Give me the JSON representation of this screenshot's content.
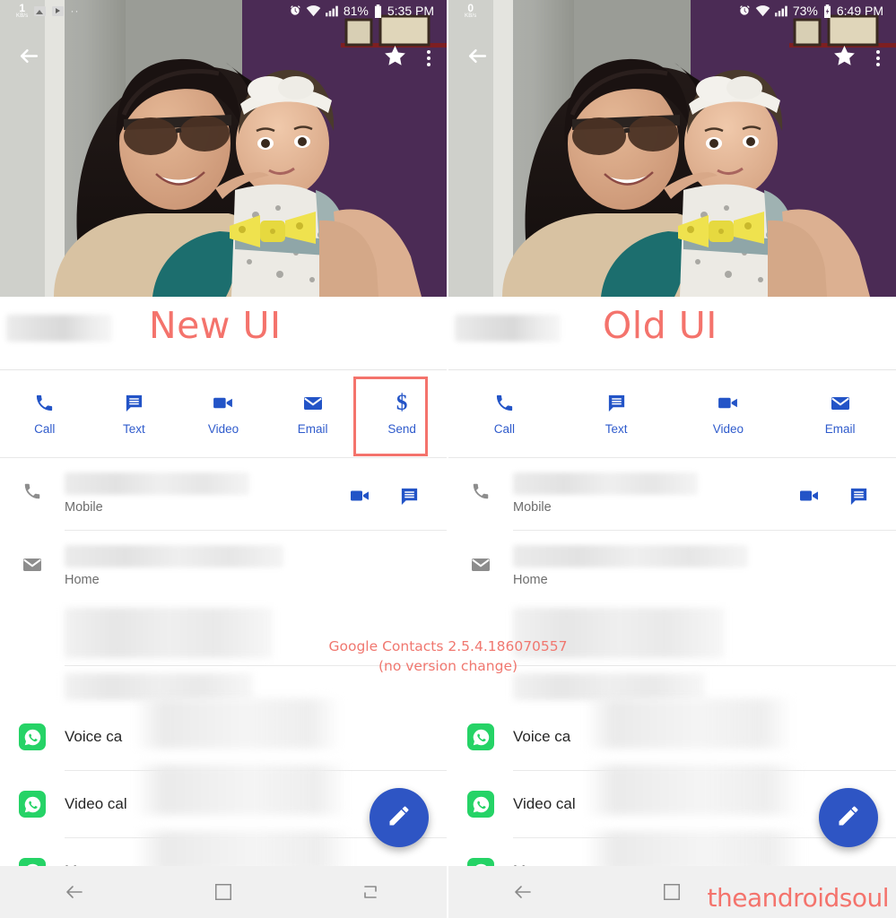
{
  "annotations": {
    "left_label": "New UI",
    "right_label": "Old UI",
    "center_note_line1": "Google Contacts 2.5.4.186070557",
    "center_note_line2": "(no version change)",
    "watermark": "theandroidsoul",
    "highlight_color": "#f4736c",
    "accent_blue": "#2354c7",
    "whatsapp_green": "#25D366",
    "fab_blue": "#2e55c4"
  },
  "left": {
    "statusbar": {
      "net_speed_value": "1",
      "net_speed_unit": "KB/s",
      "battery": "81%",
      "time": "5:35 PM",
      "icons": [
        "alarm-icon",
        "wifi-icon",
        "signal-icon",
        "battery-icon"
      ]
    },
    "appbar": {
      "back": "back-arrow-icon",
      "star": "star-icon",
      "overflow": "more-vert-icon"
    },
    "actions": [
      {
        "label": "Call",
        "icon": "phone-icon"
      },
      {
        "label": "Text",
        "icon": "message-icon"
      },
      {
        "label": "Video",
        "icon": "videocam-icon"
      },
      {
        "label": "Email",
        "icon": "email-icon"
      },
      {
        "label": "Send",
        "icon": "dollar-icon",
        "highlighted": true
      }
    ],
    "details": [
      {
        "icon": "phone-icon",
        "label": "Mobile",
        "trailing": [
          "videocam-icon",
          "message-icon"
        ]
      },
      {
        "icon": "email-icon",
        "label": "Home",
        "trailing": []
      }
    ],
    "whatsapp_rows": [
      {
        "label": "Voice ca",
        "icon": "whatsapp-icon"
      },
      {
        "label": "Video cal",
        "icon": "whatsapp-icon"
      },
      {
        "label": "Message",
        "icon": "whatsapp-icon"
      }
    ],
    "fab": {
      "icon": "pencil-icon"
    },
    "navbar": [
      {
        "icon": "nav-back-icon"
      },
      {
        "icon": "nav-home-icon"
      },
      {
        "icon": "nav-recents-icon"
      }
    ]
  },
  "right": {
    "statusbar": {
      "net_speed_value": "0",
      "net_speed_unit": "KB/s",
      "battery": "73%",
      "time": "6:49 PM",
      "icons": [
        "alarm-icon",
        "wifi-icon",
        "signal-icon",
        "battery-charging-icon"
      ]
    },
    "appbar": {
      "back": "back-arrow-icon",
      "star": "star-icon",
      "overflow": "more-vert-icon"
    },
    "actions": [
      {
        "label": "Call",
        "icon": "phone-icon"
      },
      {
        "label": "Text",
        "icon": "message-icon"
      },
      {
        "label": "Video",
        "icon": "videocam-icon"
      },
      {
        "label": "Email",
        "icon": "email-icon"
      }
    ],
    "details": [
      {
        "icon": "phone-icon",
        "label": "Mobile",
        "trailing": [
          "videocam-icon",
          "message-icon"
        ]
      },
      {
        "icon": "email-icon",
        "label": "Home",
        "trailing": []
      }
    ],
    "whatsapp_rows": [
      {
        "label": "Voice ca",
        "icon": "whatsapp-icon"
      },
      {
        "label": "Video cal",
        "icon": "whatsapp-icon"
      },
      {
        "label": "Messag",
        "icon": "whatsapp-icon"
      }
    ],
    "fab": {
      "icon": "pencil-icon"
    },
    "navbar": [
      {
        "icon": "nav-back-icon"
      },
      {
        "icon": "nav-home-icon"
      }
    ]
  }
}
